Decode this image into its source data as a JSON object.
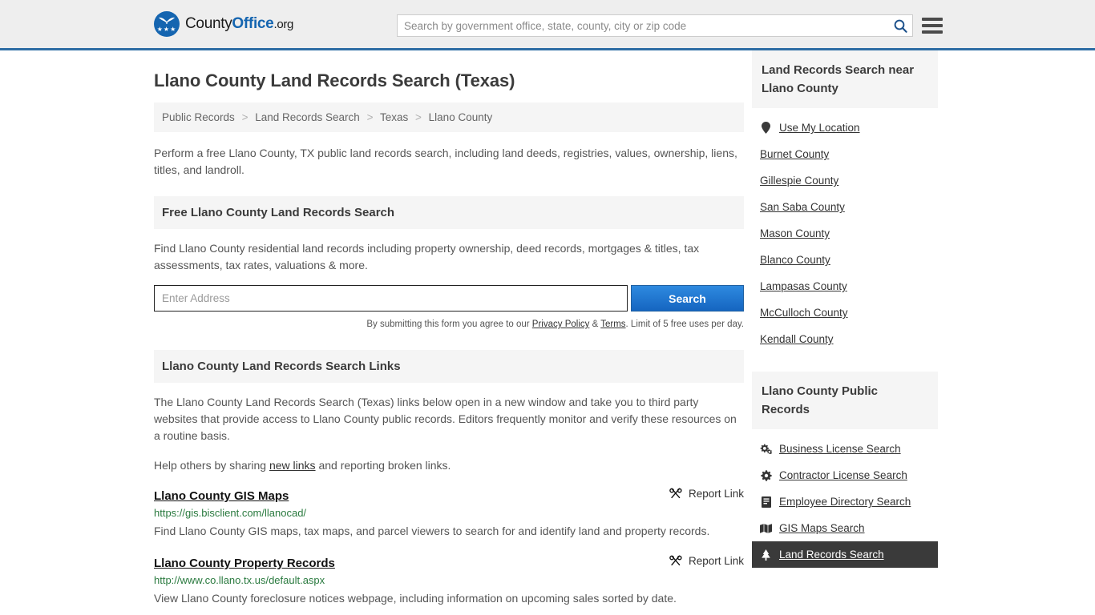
{
  "header": {
    "logo": {
      "text_part1": "County",
      "text_part2": "Office",
      "text_part3": ".org",
      "stars": "★★★"
    },
    "search": {
      "placeholder": "Search by government office, state, county, city or zip code",
      "value": "",
      "icon": "search-icon"
    },
    "menu_icon": "hamburger-menu-icon",
    "accent_color": "#2e6da4"
  },
  "main": {
    "page_title": "Llano County Land Records Search (Texas)",
    "breadcrumb": [
      "Public Records",
      "Land Records Search",
      "Texas",
      "Llano County"
    ],
    "breadcrumb_separator": ">",
    "intro": "Perform a free Llano County, TX public land records search, including land deeds, registries, values, ownership, liens, titles, and landroll.",
    "free_search": {
      "heading": "Free Llano County Land Records Search",
      "description": "Find Llano County residential land records including property ownership, deed records, mortgages & titles, tax assessments, tax rates, valuations & more.",
      "input_placeholder": "Enter Address",
      "input_value": "",
      "button_label": "Search",
      "note_prefix": "By submitting this form you agree to our ",
      "note_privacy": "Privacy Policy",
      "note_amp": " & ",
      "note_terms": "Terms",
      "note_suffix": ". Limit of 5 free uses per day."
    },
    "links_section": {
      "heading": "Llano County Land Records Search Links",
      "paragraph": "The Llano County Land Records Search (Texas) links below open in a new window and take you to third party websites that provide access to Llano County public records. Editors frequently monitor and verify these resources on a routine basis.",
      "help_prefix": "Help others by sharing ",
      "help_link": "new links",
      "help_suffix": " and reporting broken links.",
      "report_label": "Report Link",
      "report_icon": "broken-link-icon",
      "results": [
        {
          "title": "Llano County GIS Maps",
          "url": "https://gis.bisclient.com/llanocad/",
          "description": "Find Llano County GIS maps, tax maps, and parcel viewers to search for and identify land and property records."
        },
        {
          "title": "Llano County Property Records",
          "url": "http://www.co.llano.tx.us/default.aspx",
          "description": "View Llano County foreclosure notices webpage, including information on upcoming sales sorted by date."
        }
      ]
    }
  },
  "sidebar": {
    "nearby": {
      "heading": "Land Records Search near Llano County",
      "items": [
        {
          "label": "Use My Location",
          "icon": "map-pin-icon"
        },
        {
          "label": "Burnet County",
          "icon": ""
        },
        {
          "label": "Gillespie County",
          "icon": ""
        },
        {
          "label": "San Saba County",
          "icon": ""
        },
        {
          "label": "Mason County",
          "icon": ""
        },
        {
          "label": "Blanco County",
          "icon": ""
        },
        {
          "label": "Lampasas County",
          "icon": ""
        },
        {
          "label": "McCulloch County",
          "icon": ""
        },
        {
          "label": "Kendall County",
          "icon": ""
        }
      ]
    },
    "public_records": {
      "heading": "Llano County Public Records",
      "items": [
        {
          "label": "Business License Search",
          "icon": "cogs-icon",
          "active": false
        },
        {
          "label": "Contractor License Search",
          "icon": "gear-icon",
          "active": false
        },
        {
          "label": "Employee Directory Search",
          "icon": "book-icon",
          "active": false
        },
        {
          "label": "GIS Maps Search",
          "icon": "map-icon",
          "active": false
        },
        {
          "label": "Land Records Search",
          "icon": "tree-icon",
          "active": true
        }
      ]
    }
  }
}
